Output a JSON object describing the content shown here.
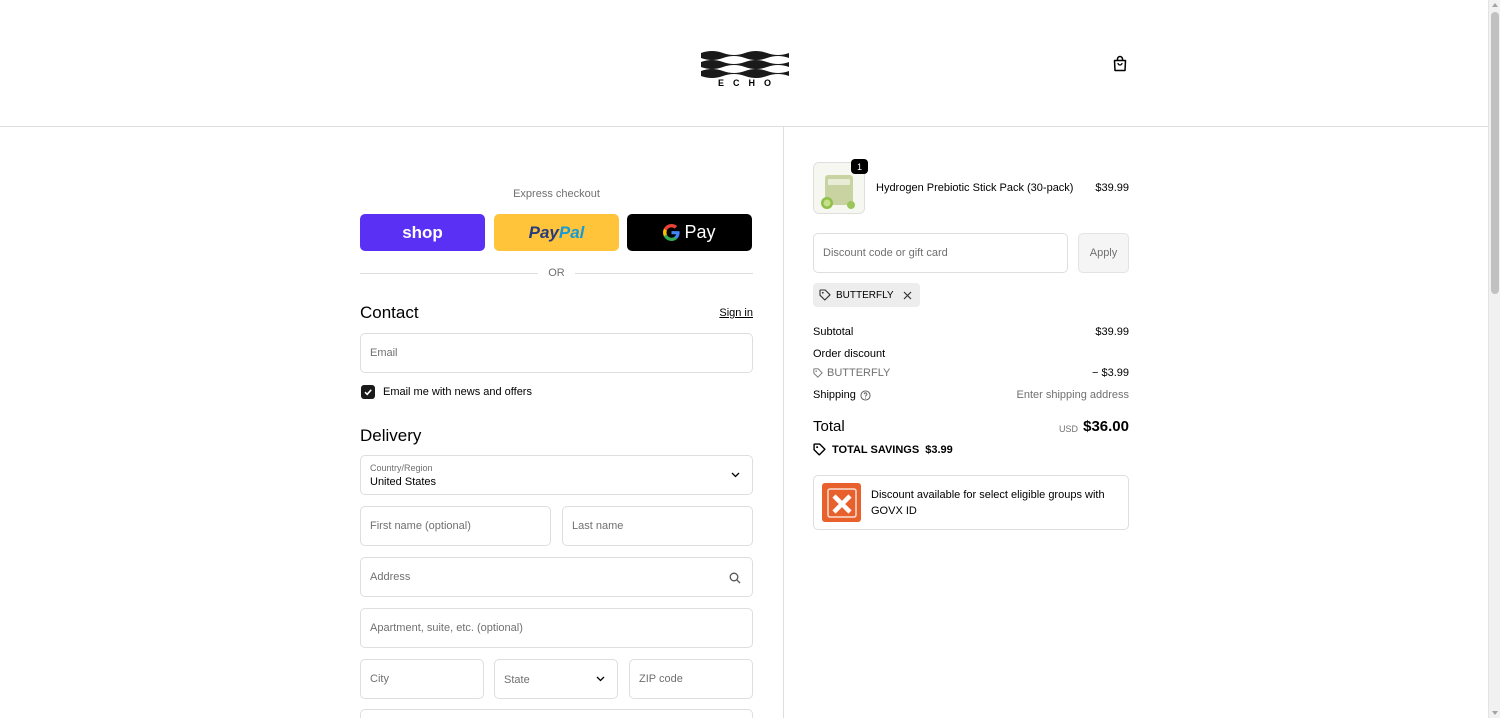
{
  "header": {
    "logo_text": "ECHO"
  },
  "express": {
    "label": "Express checkout",
    "shop_label": "shop",
    "paypal_label_1": "Pay",
    "paypal_label_2": "Pal",
    "gpay_label": "Pay",
    "or_text": "OR"
  },
  "contact": {
    "title": "Contact",
    "signin_label": "Sign in",
    "email_placeholder": "Email",
    "newsletter_label": "Email me with news and offers",
    "newsletter_checked": true
  },
  "delivery": {
    "title": "Delivery",
    "country_label": "Country/Region",
    "country_value": "United States",
    "first_name_placeholder": "First name (optional)",
    "last_name_placeholder": "Last name",
    "address_placeholder": "Address",
    "apartment_placeholder": "Apartment, suite, etc. (optional)",
    "city_placeholder": "City",
    "state_placeholder": "State",
    "zip_placeholder": "ZIP code"
  },
  "order": {
    "item_quantity": "1",
    "item_name": "Hydrogen Prebiotic Stick Pack (30-pack)",
    "item_price": "$39.99",
    "discount_placeholder": "Discount code or gift card",
    "apply_label": "Apply",
    "applied_code": "BUTTERFLY",
    "subtotal_label": "Subtotal",
    "subtotal_value": "$39.99",
    "order_discount_label": "Order discount",
    "discount_code_label": "BUTTERFLY",
    "discount_value": "− $3.99",
    "shipping_label": "Shipping",
    "shipping_value": "Enter shipping address",
    "total_label": "Total",
    "total_currency": "USD",
    "total_value": "$36.00",
    "savings_label": "TOTAL SAVINGS",
    "savings_value": "$3.99",
    "govx_text": "Discount available for select eligible groups with GOVX ID"
  },
  "colors": {
    "shop_purple": "#5a31f4",
    "paypal_yellow": "#ffc439",
    "gpay_black": "#000000",
    "govx_orange": "#e8602c"
  }
}
